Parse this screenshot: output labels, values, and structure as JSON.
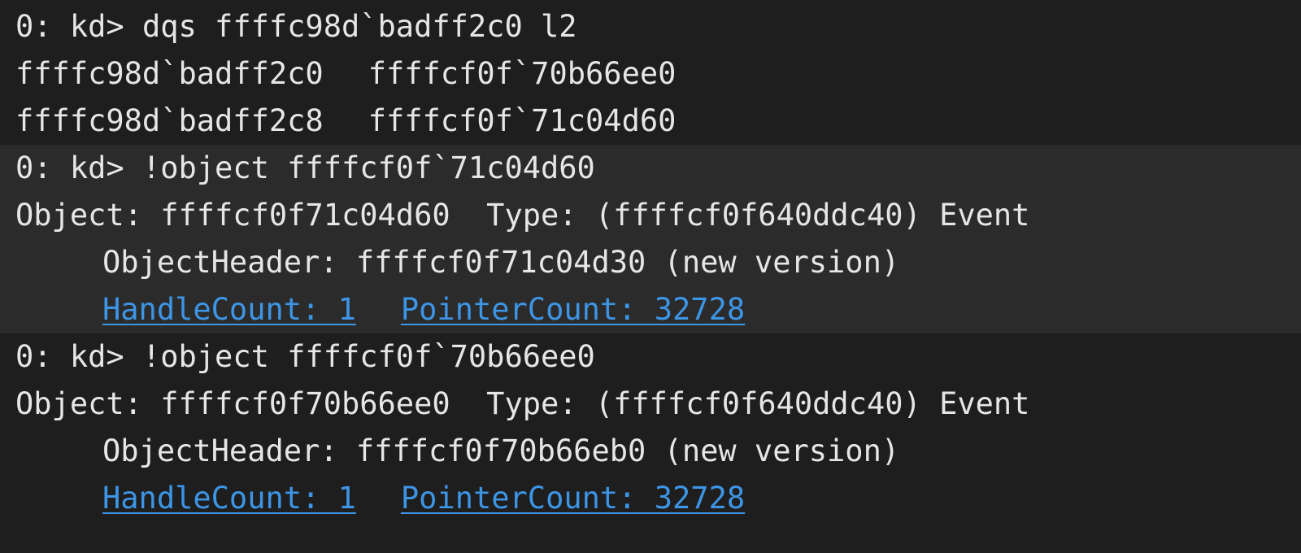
{
  "commands": [
    {
      "prompt": "0: kd> ",
      "command": "dqs ffffc98d`badff2c0 l2",
      "highlight": false,
      "rows": [
        {
          "address": "ffffc98d`badff2c0",
          "value": "ffffcf0f`70b66ee0"
        },
        {
          "address": "ffffc98d`badff2c8",
          "value": "ffffcf0f`71c04d60"
        }
      ]
    },
    {
      "prompt": "0: kd> ",
      "command": "!object ffffcf0f`71c04d60",
      "highlight": true,
      "object_line": "Object: ffffcf0f71c04d60  Type: (ffffcf0f640ddc40) Event",
      "header_line": "ObjectHeader: ffffcf0f71c04d30 (new version)",
      "handle_count": "HandleCount: 1",
      "pointer_count": "PointerCount: 32728"
    },
    {
      "prompt": "0: kd> ",
      "command": "!object ffffcf0f`70b66ee0",
      "highlight": false,
      "object_line": "Object: ffffcf0f70b66ee0  Type: (ffffcf0f640ddc40) Event",
      "header_line": "ObjectHeader: ffffcf0f70b66eb0 (new version)",
      "handle_count": "HandleCount: 1",
      "pointer_count": "PointerCount: 32728"
    }
  ],
  "colors": {
    "background": "#1e1e1e",
    "highlight_background": "#2b2b2b",
    "text": "#e6e6e6",
    "link": "#3d95e6"
  }
}
